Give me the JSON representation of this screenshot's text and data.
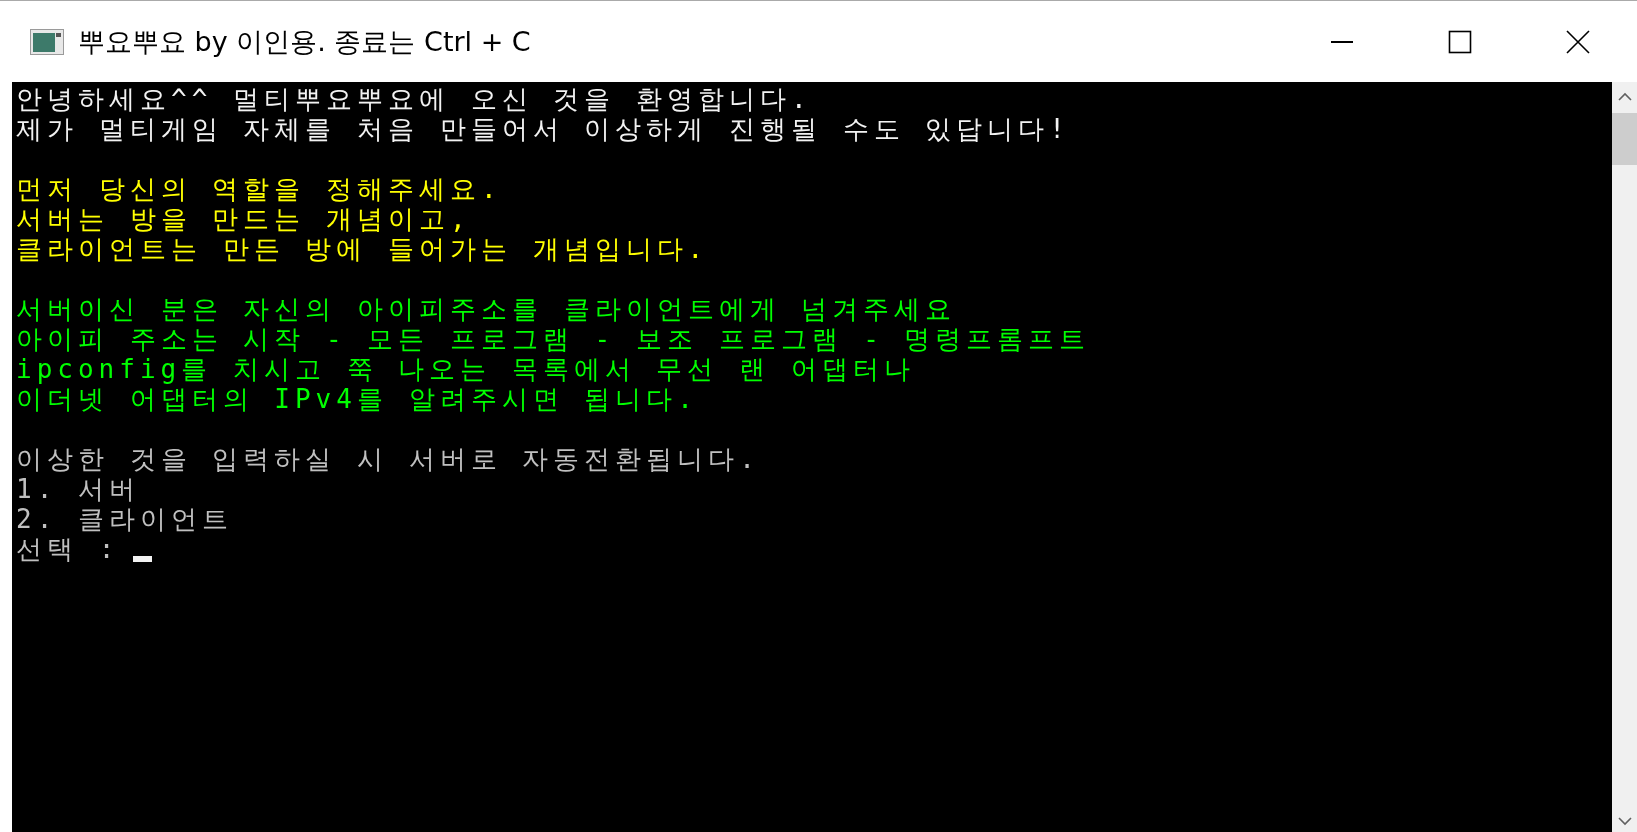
{
  "window": {
    "title": "뿌요뿌요 by 이인용. 종료는 Ctrl + C"
  },
  "console": {
    "blocks": [
      {
        "color": "#f2f2f2",
        "lines": [
          "안녕하세요^^ 멀티뿌요뿌요에 오신 것을 환영합니다.",
          "제가 멀티게임 자체를 처음 만들어서 이상하게 진행될 수도 있답니다!"
        ]
      },
      {
        "color": "#ffff00",
        "lines": [
          "먼저 당신의 역할을 정해주세요.",
          "서버는 방을 만드는 개념이고,",
          "클라이언트는 만든 방에 들어가는 개념입니다."
        ]
      },
      {
        "color": "#00ff00",
        "lines": [
          "서버이신 분은 자신의 아이피주소를 클라이언트에게 넘겨주세요",
          "아이피 주소는 시작 - 모든 프로그램 - 보조 프로그램 - 명령프롬프트",
          "ipconfig를 치시고 쭉 나오는 목록에서 무선 랜 어댑터나",
          "이더넷 어댑터의 IPv4를 알려주시면 됩니다."
        ]
      },
      {
        "color": "#c0c0c0",
        "lines": [
          "이상한 것을 입력하실 시 서버로 자동전환됩니다.",
          "1. 서버",
          "2. 클라이언트"
        ]
      }
    ],
    "prompt": "선택 :"
  }
}
